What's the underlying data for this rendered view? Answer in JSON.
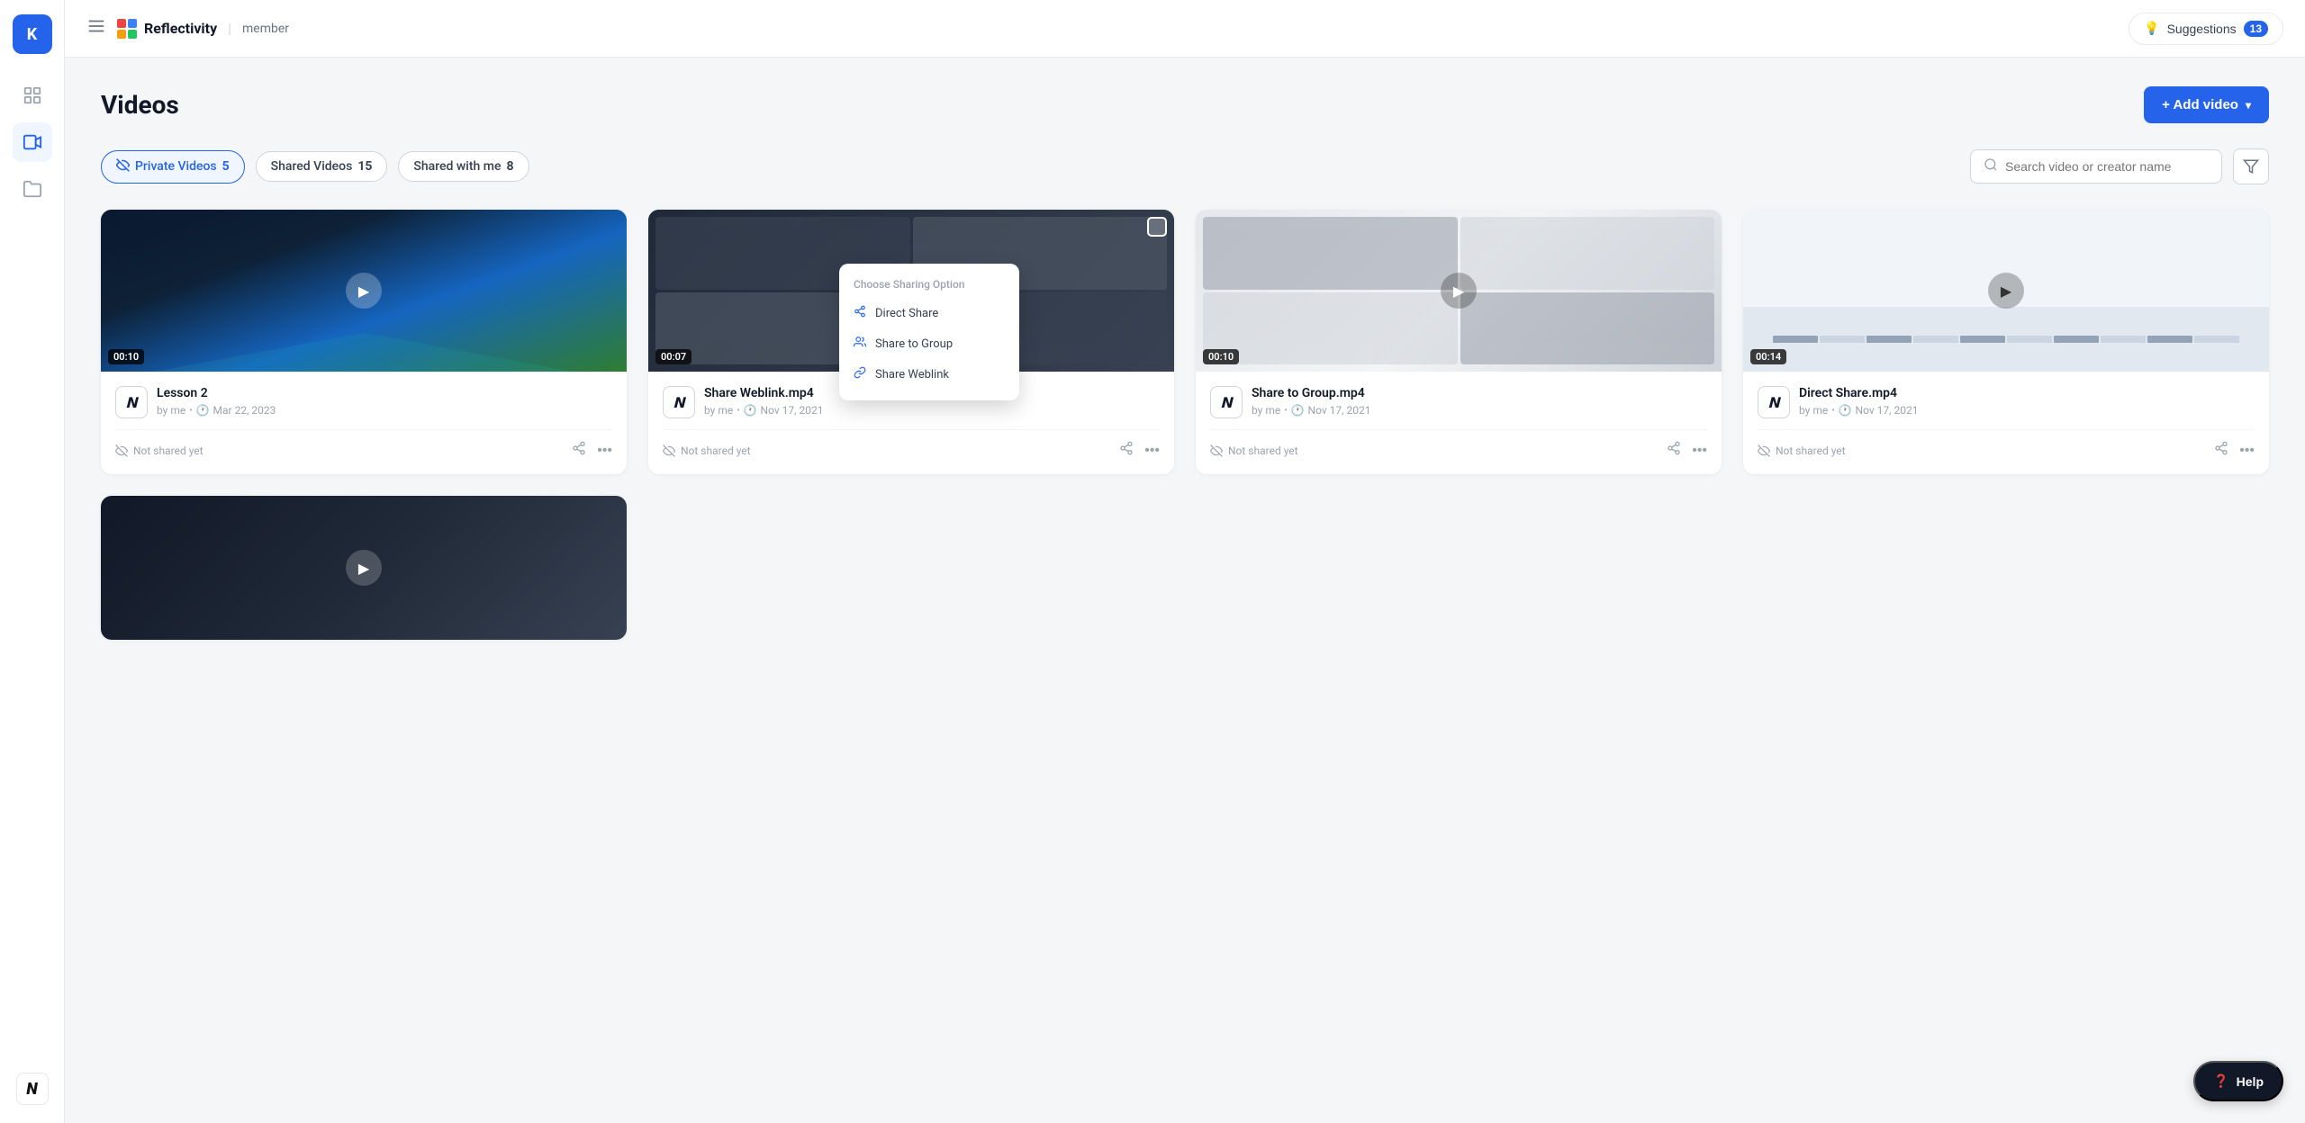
{
  "brand": {
    "name": "Reflectivity",
    "role": "member",
    "initial": "K"
  },
  "topnav": {
    "suggestions_label": "Suggestions",
    "suggestions_count": "13"
  },
  "page": {
    "title": "Videos",
    "add_video_label": "+ Add video"
  },
  "tabs": [
    {
      "id": "private",
      "label": "Private Videos",
      "count": "5",
      "active": true
    },
    {
      "id": "shared",
      "label": "Shared Videos",
      "count": "15",
      "active": false
    },
    {
      "id": "shared-with-me",
      "label": "Shared with me",
      "count": "8",
      "active": false
    }
  ],
  "search": {
    "placeholder": "Search video or creator name"
  },
  "videos": [
    {
      "id": "v1",
      "name": "Lesson 2",
      "creator": "me",
      "date": "Mar 22, 2023",
      "duration": "00:10",
      "shared_status": "Not shared yet",
      "thumb_class": "thumb-lesson2"
    },
    {
      "id": "v2",
      "name": "Share Weblink.mp4",
      "creator": "me",
      "date": "Nov 17, 2021",
      "duration": "00:07",
      "shared_status": "Not shared yet",
      "thumb_class": "thumb-shareweblink",
      "has_dropdown": true
    },
    {
      "id": "v3",
      "name": "Share to Group.mp4",
      "creator": "me",
      "date": "Nov 17, 2021",
      "duration": "00:10",
      "shared_status": "Not shared yet",
      "thumb_class": "thumb-sharegroup"
    },
    {
      "id": "v4",
      "name": "Direct Share.mp4",
      "creator": "me",
      "date": "Nov 17, 2021",
      "duration": "00:14",
      "shared_status": "Not shared yet",
      "thumb_class": "thumb-directshare"
    }
  ],
  "share_dropdown": {
    "title": "Choose Sharing Option",
    "items": [
      {
        "label": "Direct Share"
      },
      {
        "label": "Share to Group"
      },
      {
        "label": "Share Weblink"
      }
    ]
  },
  "help": {
    "label": "Help"
  },
  "sidebar": {
    "items": [
      {
        "id": "dashboard",
        "icon": "⊞",
        "label": "Dashboard"
      },
      {
        "id": "videos",
        "icon": "▶",
        "label": "Videos",
        "active": true
      },
      {
        "id": "files",
        "icon": "📁",
        "label": "Files"
      }
    ]
  }
}
